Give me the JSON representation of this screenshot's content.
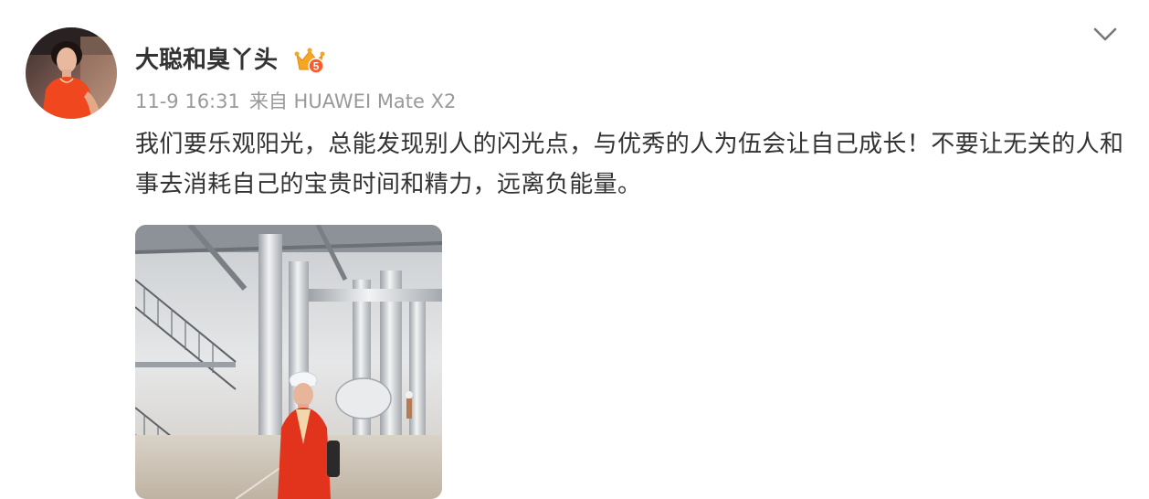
{
  "post": {
    "author": {
      "name": "大聪和臭丫头",
      "vip_level": "5",
      "avatar_icon": "avatar-portrait-icon"
    },
    "time": "11-9 16:31",
    "source": "来自 HUAWEI Mate X2",
    "text": "我们要乐观阳光，总能发现别人的闪光点，与优秀的人为伍会让自己成长！不要让无关的人和事去消耗自己的宝贵时间和精力，远离负能量。",
    "image_icon": "photo-industrial-hall",
    "more_icon": "chevron-down-icon"
  },
  "colors": {
    "text": "#333333",
    "meta": "#999999",
    "vip_gold": "#f5a623",
    "vip_red": "#ff5a2c"
  }
}
